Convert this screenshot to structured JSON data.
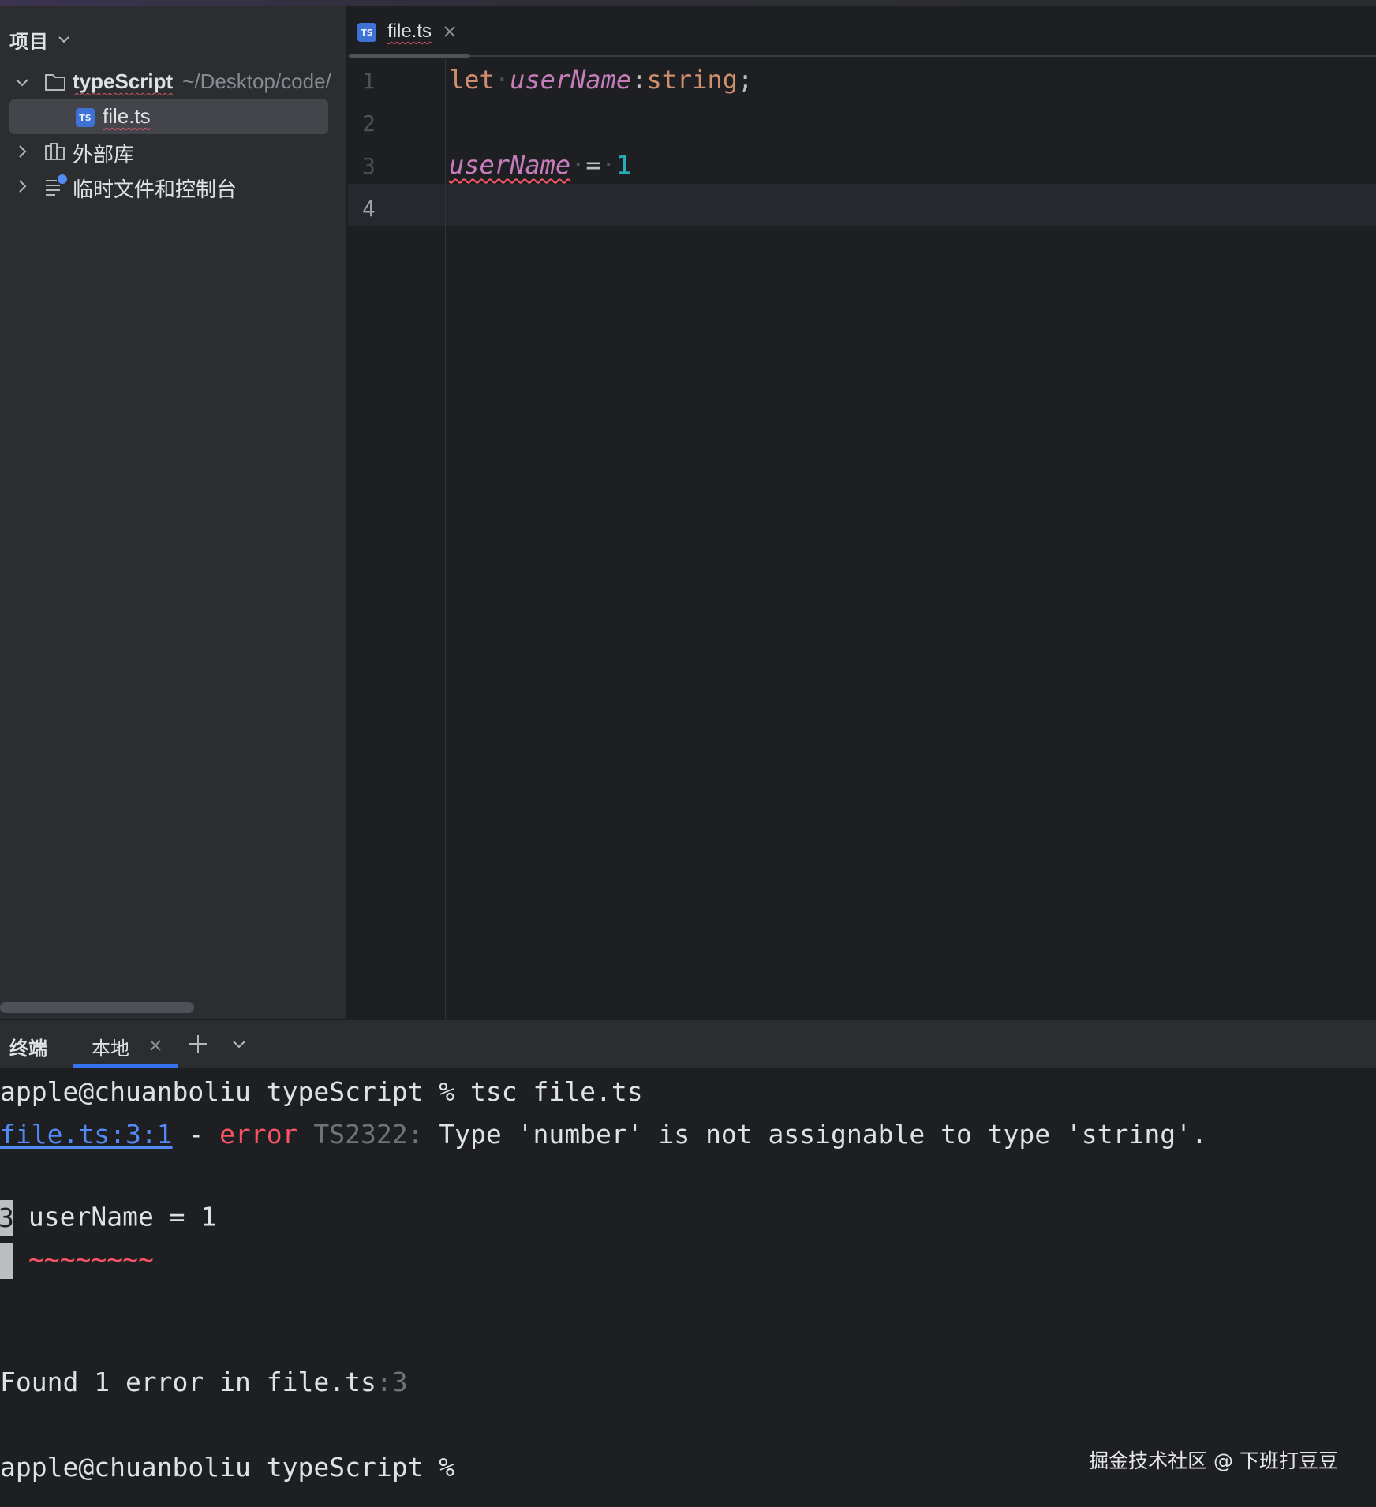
{
  "project_panel": {
    "title": "项目",
    "tree": {
      "root_name": "typeScript",
      "root_path": "~/Desktop/code/",
      "file": "file.ts",
      "file_badge": "TS",
      "external_libs": "外部库",
      "scratches": "临时文件和控制台"
    }
  },
  "editor": {
    "tab": {
      "label": "file.ts",
      "badge": "TS"
    },
    "line_numbers": [
      "1",
      "2",
      "3",
      "4"
    ],
    "code": {
      "line1": {
        "kw": "let",
        "var": "userName",
        "colon": ":",
        "type": "string",
        "semi": ";"
      },
      "line3": {
        "var": "userName",
        "eq": "=",
        "num": "1"
      }
    }
  },
  "terminal": {
    "title": "终端",
    "tab_label": "本地",
    "lines": {
      "cmd1": "apple@chuanboliu typeScript % tsc file.ts",
      "err_link": "file.ts:3:1",
      "err_dash": " - ",
      "err_word": "error",
      "err_code": " TS2322: ",
      "err_msg": "Type 'number' is not assignable to type 'string'.",
      "src_num": "3",
      "src_code": " userName = 1",
      "tildes": "~~~~~~~~",
      "found": "Found 1 error in file.ts",
      "found_loc": ":3",
      "prompt": "apple@chuanboliu typeScript %"
    }
  },
  "watermark": "掘金技术社区 @ 下班打豆豆",
  "colors": {
    "background": "#1e1f22",
    "panel": "#2b2d30",
    "keyword": "#cf8e6d",
    "variable": "#c77dbb",
    "number": "#2aacb8",
    "error": "#f75464",
    "link": "#548af7",
    "accent": "#3574f0"
  }
}
